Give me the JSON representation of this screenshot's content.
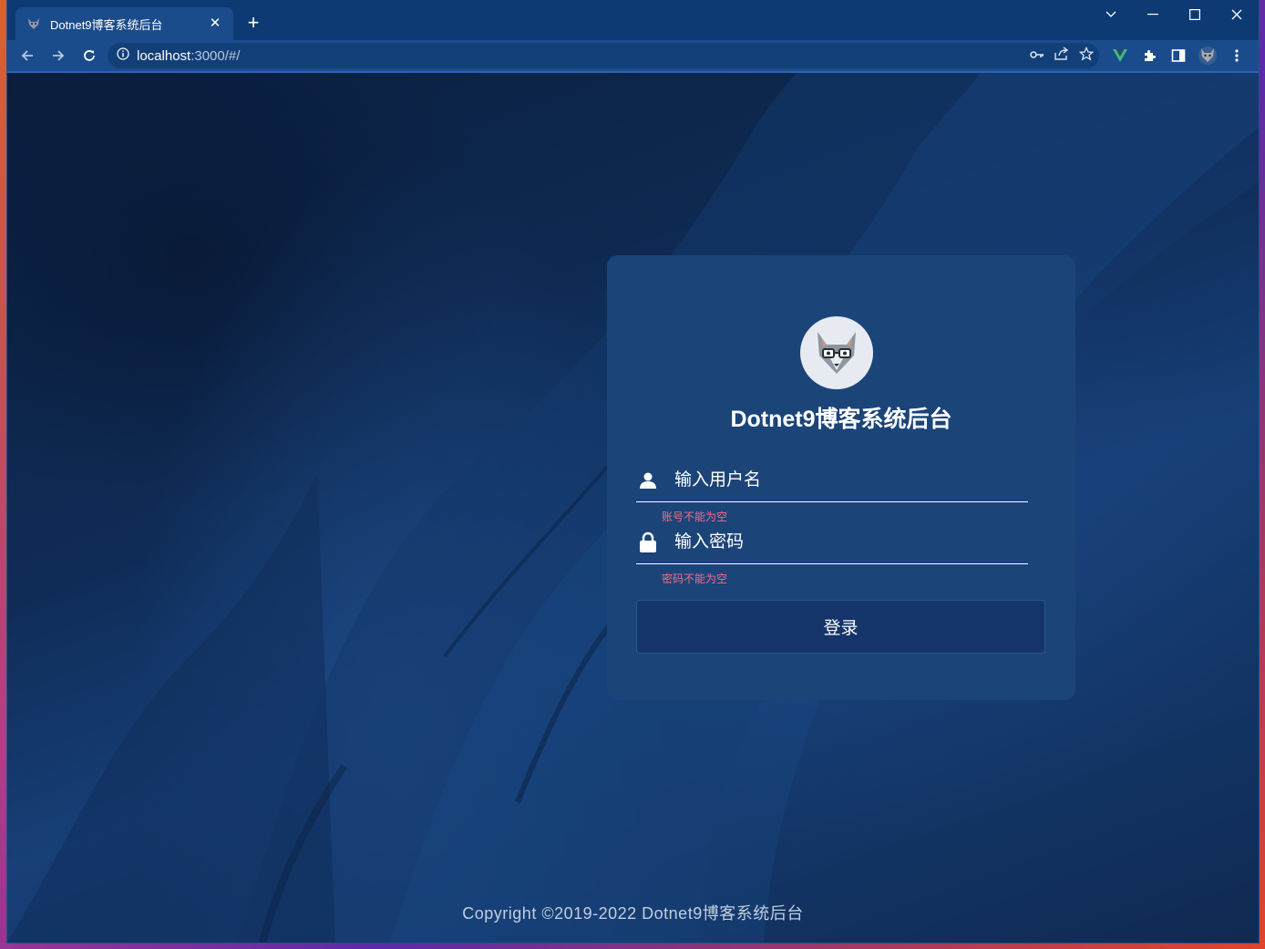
{
  "browser": {
    "tab_title": "Dotnet9博客系统后台",
    "url_host": "localhost",
    "url_path": ":3000/#/"
  },
  "login": {
    "title": "Dotnet9博客系统后台",
    "username_placeholder": "输入用户名",
    "username_error": "账号不能为空",
    "password_placeholder": "输入密码",
    "password_error": "密码不能为空",
    "submit_label": "登录"
  },
  "footer": {
    "copyright": "Copyright ©2019-2022 Dotnet9博客系统后台"
  },
  "colors": {
    "tab_bar": "#0d3a73",
    "toolbar": "#1a4c8c",
    "card": "#1b4479",
    "error": "#f56c8a",
    "button": "#15356a"
  }
}
